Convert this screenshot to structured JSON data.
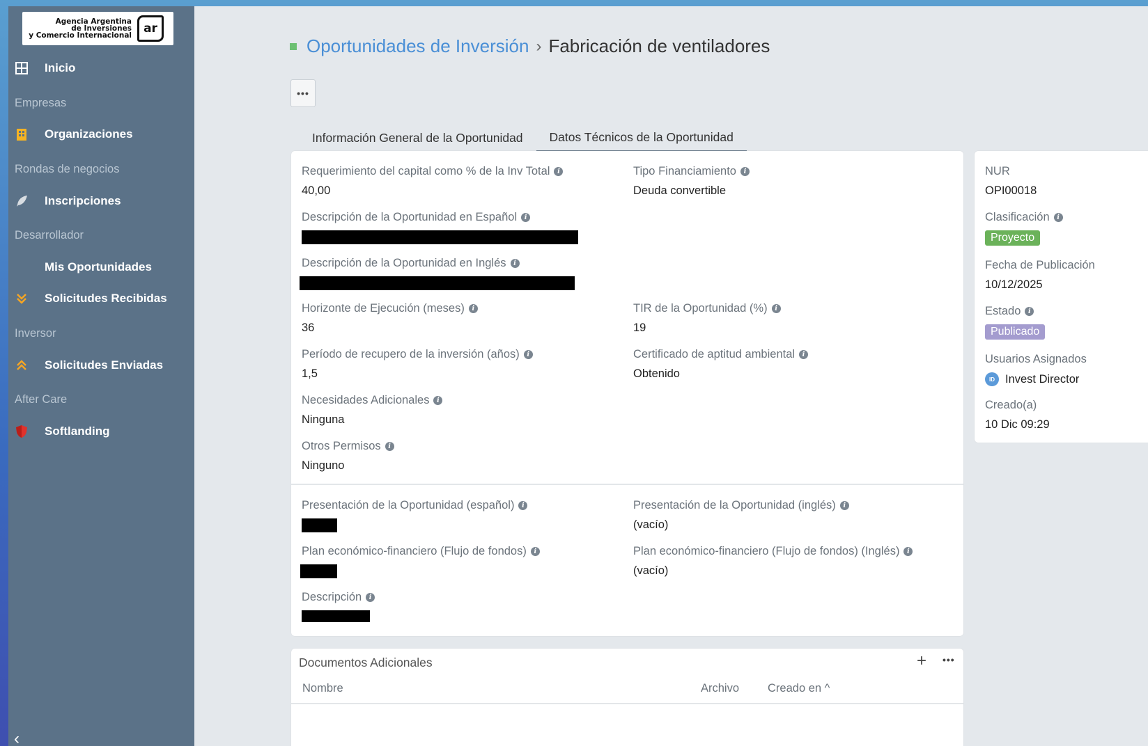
{
  "sidebar": {
    "logo": {
      "line1": "Agencia Argentina",
      "line2": "de Inversiones",
      "line3": "y Comercio Internacional",
      "badge": "ar"
    },
    "items": [
      {
        "label": "Inicio",
        "icon": "grid-icon"
      },
      {
        "section": "Empresas"
      },
      {
        "label": "Organizaciones",
        "icon": "building-icon"
      },
      {
        "section": "Rondas de negocios"
      },
      {
        "label": "Inscripciones",
        "icon": "feather-icon"
      },
      {
        "section": "Desarrollador"
      },
      {
        "label": "Mis Oportunidades"
      },
      {
        "label": "Solicitudes Recibidas",
        "icon": "double-chevron-down-icon"
      },
      {
        "section": "Inversor"
      },
      {
        "label": "Solicitudes Enviadas",
        "icon": "double-chevron-up-icon"
      },
      {
        "section": "After Care"
      },
      {
        "label": "Softlanding",
        "icon": "shield-icon"
      }
    ],
    "collapse": "‹"
  },
  "breadcrumb": {
    "parent": "Oportunidades de Inversión",
    "separator": "›",
    "current": "Fabricación de ventiladores"
  },
  "more_button": "•••",
  "tabs": [
    {
      "label": "Información General de la Oportunidad",
      "active": false
    },
    {
      "label": "Datos Técnicos de la Oportunidad",
      "active": true
    }
  ],
  "fields": {
    "capital": {
      "label": "Requerimiento del capital como % de la Inv Total",
      "value": "40,00"
    },
    "tipo": {
      "label": "Tipo Financiamiento",
      "value": "Deuda convertible"
    },
    "desc_es": {
      "label": "Descripción de la Oportunidad en Español"
    },
    "desc_en": {
      "label": "Descripción de la Oportunidad en Inglés"
    },
    "horizonte": {
      "label": "Horizonte de Ejecución (meses)",
      "value": "36"
    },
    "tir": {
      "label": "TIR de la Oportunidad (%)",
      "value": "19"
    },
    "periodo": {
      "label": "Período de recupero de la inversión (años)",
      "value": "1,5"
    },
    "certificado": {
      "label": "Certificado de aptitud ambiental",
      "value": "Obtenido"
    },
    "necesidades": {
      "label": "Necesidades Adicionales",
      "value": "Ninguna"
    },
    "permisos": {
      "label": "Otros Permisos",
      "value": "Ninguno"
    },
    "pres_es": {
      "label": "Presentación de la Oportunidad (español)"
    },
    "pres_en": {
      "label": "Presentación de la Oportunidad (inglés)",
      "value": "(vacío)"
    },
    "plan": {
      "label": "Plan económico-financiero (Flujo de fondos)"
    },
    "plan_en": {
      "label": "Plan económico-financiero (Flujo de fondos) (Inglés)",
      "value": "(vacío)"
    },
    "descripcion": {
      "label": "Descripción"
    }
  },
  "side": {
    "nur": {
      "label": "NUR",
      "value": "OPI00018"
    },
    "clasificacion": {
      "label": "Clasificación",
      "value": "Proyecto"
    },
    "fecha": {
      "label": "Fecha de Publicación",
      "value": "10/12/2025"
    },
    "estado": {
      "label": "Estado",
      "value": "Publicado"
    },
    "usuarios": {
      "label": "Usuarios Asignados",
      "initials": "ID",
      "value": "Invest Director"
    },
    "creado": {
      "label": "Creado(a)",
      "value": "10 Dic 09:29"
    }
  },
  "docs": {
    "title": "Documentos Adicionales",
    "add": "+",
    "more": "•••",
    "columns": {
      "nombre": "Nombre",
      "archivo": "Archivo",
      "creado": "Creado en ^"
    }
  },
  "colors": {
    "accent": "#4a8fd6",
    "sidebar": "#5b7288",
    "green": "#6bb25a",
    "purple": "#a49ccf"
  }
}
